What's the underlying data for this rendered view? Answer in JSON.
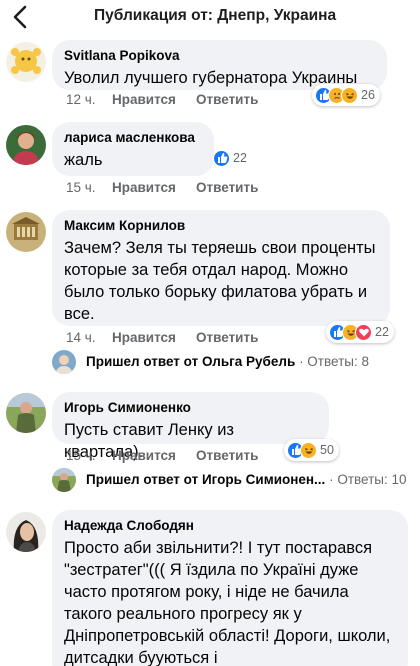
{
  "header": {
    "title": "Публикация от: Днепр, Украина"
  },
  "comments": [
    {
      "author": "Svitlana Popikova",
      "text": "Уволил лучшего губернатора Украины",
      "time": "12 ч.",
      "like_label": "Нравится",
      "reply_label": "Ответить",
      "reaction_count": "26",
      "reactions": [
        "like-icon",
        "sad-icon",
        "haha-icon"
      ]
    },
    {
      "author": "лариса масленкова",
      "text": "жаль",
      "time": "15 ч.",
      "like_label": "Нравится",
      "reply_label": "Ответить",
      "reaction_count": "22",
      "reactions": [
        "like-icon"
      ]
    },
    {
      "author": "Максим Корнилов",
      "text": "Зачем? Зеля ты теряешь свои проценты которые за тебя отдал народ. Можно было только борьку филатова убрать и все.",
      "time": "14 ч.",
      "like_label": "Нравится",
      "reply_label": "Ответить",
      "reaction_count": "22",
      "reactions": [
        "like-icon",
        "haha-icon",
        "love-icon"
      ],
      "replies": {
        "prefix": "Пришел ответ от",
        "name": "Ольга Рубель",
        "count": "· Ответы: 8"
      }
    },
    {
      "author": "Игорь Симионенко",
      "text": "Пусть ставит Ленку из квартала).",
      "time": "15 ч.",
      "like_label": "Нравится",
      "reply_label": "Ответить",
      "reaction_count": "50",
      "reactions": [
        "like-icon",
        "haha-icon"
      ],
      "replies": {
        "prefix": "Пришел ответ от",
        "name": "Игорь Симионен...",
        "count": "· Ответы: 10"
      }
    },
    {
      "author": "Надежда Слободян",
      "text": "Просто аби звільнити?! І тут постарався \"зестратег\"((( Я їздила по Україні дуже часто протягом року, і ніде не бачила такого реального прогресу як у Дніпропетровській області! Дороги, школи, дитсадки бууються і"
    }
  ],
  "colors": {
    "bubble": "#f0f2f5",
    "meta_text": "#65676b",
    "like_blue": "#1877f2",
    "love_red": "#f33e58",
    "haha_yellow": "#f7b125"
  }
}
